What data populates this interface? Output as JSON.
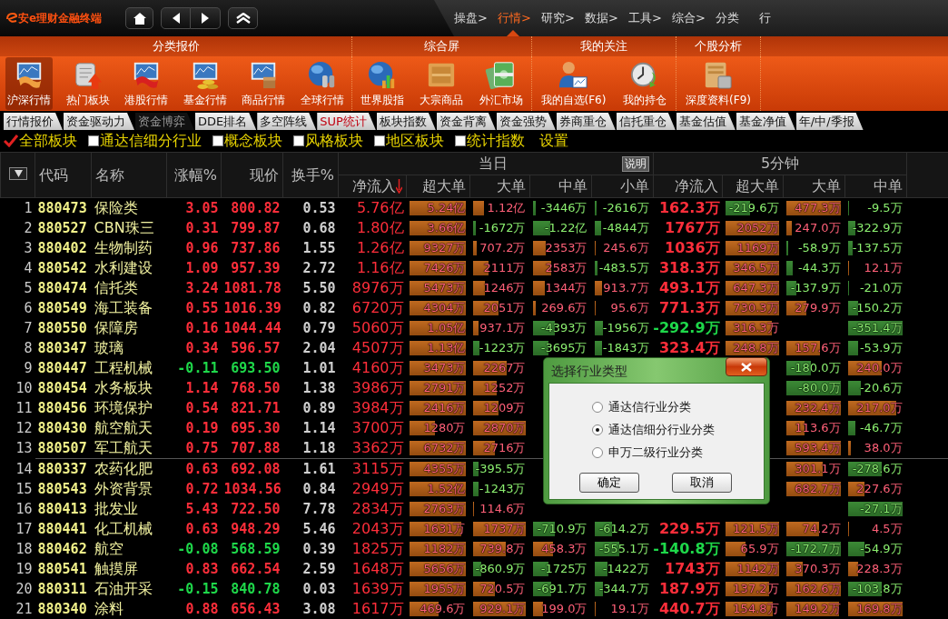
{
  "app": {
    "logo": "安e理财金融终端"
  },
  "menu": [
    {
      "label": "操盘>",
      "selected": false
    },
    {
      "label": "行情>",
      "selected": true
    },
    {
      "label": "研究>",
      "selected": false
    },
    {
      "label": "数据>",
      "selected": false
    },
    {
      "label": "工具>",
      "selected": false
    },
    {
      "label": "综合>",
      "selected": false
    },
    {
      "label": "分类",
      "selected": false
    },
    {
      "label": "行",
      "selected": false
    }
  ],
  "ribbon": {
    "groups": [
      {
        "title": "分类报价",
        "items": [
          {
            "label": "沪深行情",
            "selected": true
          },
          {
            "label": "热门板块",
            "selected": false
          },
          {
            "label": "港股行情",
            "selected": false
          },
          {
            "label": "基金行情",
            "selected": false
          },
          {
            "label": "商品行情",
            "selected": false
          },
          {
            "label": "全球行情",
            "selected": false
          }
        ]
      },
      {
        "title": "综合屏",
        "items": [
          {
            "label": "世界股指",
            "selected": false
          },
          {
            "label": "大宗商品",
            "selected": false
          },
          {
            "label": "外汇市场",
            "selected": false
          }
        ]
      },
      {
        "title": "我的关注",
        "items": [
          {
            "label": "我的自选(F6)",
            "selected": false
          },
          {
            "label": "我的持仓",
            "selected": false
          }
        ]
      },
      {
        "title": "个股分析",
        "items": [
          {
            "label": "深度资料(F9)",
            "selected": false
          }
        ]
      }
    ]
  },
  "tabs": [
    {
      "label": "行情报价",
      "selected": false,
      "highlighted": false
    },
    {
      "label": "资金驱动力",
      "selected": false,
      "highlighted": false
    },
    {
      "label": "资金博弈",
      "selected": true,
      "highlighted": false
    },
    {
      "label": "DDE排名",
      "selected": false,
      "highlighted": false
    },
    {
      "label": "多空阵线",
      "selected": false,
      "highlighted": false
    },
    {
      "label": "SUP统计",
      "selected": false,
      "highlighted": true
    },
    {
      "label": "板块指数",
      "selected": false,
      "highlighted": false
    },
    {
      "label": "资金背离",
      "selected": false,
      "highlighted": false
    },
    {
      "label": "资金强势",
      "selected": false,
      "highlighted": false
    },
    {
      "label": "券商重仓",
      "selected": false,
      "highlighted": false
    },
    {
      "label": "信托重仓",
      "selected": false,
      "highlighted": false
    },
    {
      "label": "基金估值",
      "selected": false,
      "highlighted": false
    },
    {
      "label": "基金净值",
      "selected": false,
      "highlighted": false
    },
    {
      "label": "年/中/季报",
      "selected": false,
      "highlighted": false
    }
  ],
  "filters": [
    {
      "label": "全部板块",
      "checked": true
    },
    {
      "label": "通达信细分行业",
      "checked": false
    },
    {
      "label": "概念板块",
      "checked": false
    },
    {
      "label": "风格板块",
      "checked": false
    },
    {
      "label": "地区板块",
      "checked": false
    },
    {
      "label": "统计指数",
      "checked": false
    }
  ],
  "settings_link": "设置",
  "table": {
    "columns": [
      "代码",
      "名称",
      "涨幅%",
      "现价",
      "换手%"
    ],
    "groups": [
      {
        "label": "当日",
        "note_button": "说明",
        "columns": [
          {
            "label": "净流入",
            "sorted": true
          },
          {
            "label": "超大单",
            "sorted": false
          },
          {
            "label": "大单",
            "sorted": false
          },
          {
            "label": "中单",
            "sorted": false
          },
          {
            "label": "小单",
            "sorted": false
          }
        ]
      },
      {
        "label": "5分钟",
        "columns": [
          {
            "label": "净流入",
            "sorted": false
          },
          {
            "label": "超大单",
            "sorted": false
          },
          {
            "label": "大单",
            "sorted": false
          },
          {
            "label": "中单",
            "sorted": false
          }
        ]
      }
    ],
    "rows": [
      {
        "no": "1",
        "code": "880473",
        "name": "保险类",
        "change": "3.05",
        "price": "800.82",
        "turnover": "0.53",
        "today": {
          "net": {
            "text": "5.76亿"
          },
          "super_large": {
            "text": "5.24亿",
            "level": 0.97
          },
          "large": {
            "text": "1.12亿",
            "level": 0.2
          },
          "medium": {
            "text": "-3446万",
            "level": 0.05
          },
          "small": {
            "text": "-2616万",
            "level": 0.04
          }
        },
        "five_min": {
          "net": {
            "text": "162.3万"
          },
          "super_large": {
            "text": "-219.6万",
            "level": 0.45
          },
          "large": {
            "text": "477.3万",
            "level": 0.97
          },
          "medium": {
            "text": "-9.5万",
            "level": 0.03
          }
        }
      },
      {
        "no": "2",
        "code": "880527",
        "name": "CBN珠三",
        "change": "0.31",
        "price": "799.87",
        "turnover": "0.68",
        "today": {
          "net": {
            "text": "1.80亿"
          },
          "super_large": {
            "text": "3.66亿",
            "level": 0.97
          },
          "large": {
            "text": "-1672万",
            "level": 0.05
          },
          "medium": {
            "text": "-1.22亿",
            "level": 0.32
          },
          "small": {
            "text": "-4844万",
            "level": 0.12
          }
        },
        "five_min": {
          "net": {
            "text": "1767万"
          },
          "super_large": {
            "text": "2052万",
            "level": 0.97
          },
          "large": {
            "text": "247.0万",
            "level": 0.1
          },
          "medium": {
            "text": "-322.9万",
            "level": 0.14
          }
        }
      },
      {
        "no": "3",
        "code": "880402",
        "name": "生物制药",
        "change": "0.96",
        "price": "737.86",
        "turnover": "1.55",
        "today": {
          "net": {
            "text": "1.26亿"
          },
          "super_large": {
            "text": "9327万",
            "level": 0.97
          },
          "large": {
            "text": "707.2万",
            "level": 0.08
          },
          "medium": {
            "text": "2353万",
            "level": 0.24
          },
          "small": {
            "text": "245.6万",
            "level": 0.03
          }
        },
        "five_min": {
          "net": {
            "text": "1036万"
          },
          "super_large": {
            "text": "1169万",
            "level": 0.97
          },
          "large": {
            "text": "-58.9万",
            "level": 0.04
          },
          "medium": {
            "text": "-137.5万",
            "level": 0.09
          }
        }
      },
      {
        "no": "4",
        "code": "880542",
        "name": "水利建设",
        "change": "1.09",
        "price": "957.39",
        "turnover": "2.72",
        "today": {
          "net": {
            "text": "1.16亿"
          },
          "super_large": {
            "text": "7426万",
            "level": 0.97
          },
          "large": {
            "text": "2111万",
            "level": 0.29
          },
          "medium": {
            "text": "2583万",
            "level": 0.33
          },
          "small": {
            "text": "-483.5万",
            "level": 0.05
          }
        },
        "five_min": {
          "net": {
            "text": "318.3万"
          },
          "super_large": {
            "text": "346.5万",
            "level": 0.97
          },
          "large": {
            "text": "-44.3万",
            "level": 0.12
          },
          "medium": {
            "text": "12.1万",
            "level": 0.02
          }
        }
      },
      {
        "no": "5",
        "code": "880474",
        "name": "信托类",
        "change": "3.24",
        "price": "1081.78",
        "turnover": "5.50",
        "today": {
          "net": {
            "text": "8976万"
          },
          "super_large": {
            "text": "5473万",
            "level": 0.97
          },
          "large": {
            "text": "1246万",
            "level": 0.23
          },
          "medium": {
            "text": "1344万",
            "level": 0.22
          },
          "small": {
            "text": "913.7万",
            "level": 0.14
          }
        },
        "five_min": {
          "net": {
            "text": "493.1万"
          },
          "super_large": {
            "text": "647.3万",
            "level": 0.97
          },
          "large": {
            "text": "-137.9万",
            "level": 0.19
          },
          "medium": {
            "text": "-21.0万",
            "level": 0.02
          }
        }
      },
      {
        "no": "6",
        "code": "880549",
        "name": "海工装备",
        "change": "0.55",
        "price": "1016.39",
        "turnover": "0.82",
        "today": {
          "net": {
            "text": "6720万"
          },
          "super_large": {
            "text": "4304万",
            "level": 0.97
          },
          "large": {
            "text": "2051万",
            "level": 0.47
          },
          "medium": {
            "text": "269.6万",
            "level": 0.05
          },
          "small": {
            "text": "95.6万",
            "level": 0.02
          }
        },
        "five_min": {
          "net": {
            "text": "771.3万"
          },
          "super_large": {
            "text": "730.3万",
            "level": 0.97
          },
          "large": {
            "text": "279.9万",
            "level": 0.36
          },
          "medium": {
            "text": "-150.2万",
            "level": 0.19
          }
        }
      },
      {
        "no": "7",
        "code": "880550",
        "name": "保障房",
        "change": "0.16",
        "price": "1044.44",
        "turnover": "0.79",
        "today": {
          "net": {
            "text": "5060万"
          },
          "super_large": {
            "text": "1.05亿",
            "level": 0.97
          },
          "large": {
            "text": "937.1万",
            "level": 0.1
          },
          "medium": {
            "text": "-4393万",
            "level": 0.39
          },
          "small": {
            "text": "-1956万",
            "level": 0.15
          }
        },
        "five_min": {
          "net": {
            "text": "-292.9万"
          },
          "super_large": {
            "text": "316.3万",
            "level": 0.85
          },
          "medium": {
            "text": "-351.4万",
            "level": 0.97
          }
        }
      },
      {
        "no": "8",
        "code": "880347",
        "name": "玻璃",
        "change": "0.34",
        "price": "596.57",
        "turnover": "2.04",
        "today": {
          "net": {
            "text": "4507万"
          },
          "super_large": {
            "text": "1.13亿",
            "level": 0.97
          },
          "large": {
            "text": "-1223万",
            "level": 0.12
          },
          "medium": {
            "text": "-3695万",
            "level": 0.29
          },
          "small": {
            "text": "-1843万",
            "level": 0.14
          }
        },
        "five_min": {
          "net": {
            "text": "323.4万"
          },
          "super_large": {
            "text": "248.8万",
            "level": 0.97
          },
          "large": {
            "text": "157.6万",
            "level": 0.6
          },
          "medium": {
            "text": "-53.9万",
            "level": 0.19
          }
        }
      },
      {
        "no": "9",
        "code": "880447",
        "name": "工程机械",
        "change": "-0.11",
        "price": "693.50",
        "turnover": "1.01",
        "today": {
          "net": {
            "text": "4160万"
          },
          "super_large": {
            "text": "3473万",
            "level": 0.97
          },
          "large": {
            "text": "2267万",
            "level": 0.62
          }
        },
        "five_min": {
          "large": {
            "text": "-180.0万",
            "level": 0.45
          },
          "medium": {
            "text": "240.0万",
            "level": 0.6
          }
        }
      },
      {
        "no": "10",
        "code": "880454",
        "name": "水务板块",
        "change": "1.14",
        "price": "768.50",
        "turnover": "1.38",
        "today": {
          "net": {
            "text": "3986万"
          },
          "super_large": {
            "text": "2791万",
            "level": 0.97
          },
          "large": {
            "text": "1252万",
            "level": 0.44
          }
        },
        "five_min": {
          "large": {
            "text": "-80.0万",
            "level": 0.97
          },
          "medium": {
            "text": "-20.6万",
            "level": 0.23
          }
        }
      },
      {
        "no": "11",
        "code": "880456",
        "name": "环境保护",
        "change": "0.54",
        "price": "821.71",
        "turnover": "0.89",
        "today": {
          "net": {
            "text": "3984万"
          },
          "super_large": {
            "text": "2416万",
            "level": 0.97
          },
          "large": {
            "text": "1209万",
            "level": 0.48
          }
        },
        "five_min": {
          "large": {
            "text": "232.4万",
            "level": 0.97
          },
          "medium": {
            "text": "217.0万",
            "level": 0.86
          }
        }
      },
      {
        "no": "12",
        "code": "880430",
        "name": "航空航天",
        "change": "0.19",
        "price": "695.30",
        "turnover": "1.14",
        "today": {
          "net": {
            "text": "3700万"
          },
          "super_large": {
            "text": "1280万",
            "level": 0.44
          },
          "large": {
            "text": "2870万",
            "level": 0.97
          }
        },
        "five_min": {
          "large": {
            "text": "113.6万",
            "level": 0.33
          },
          "medium": {
            "text": "-46.7万",
            "level": 0.13
          }
        }
      },
      {
        "no": "13",
        "code": "880507",
        "name": "军工航天",
        "change": "0.75",
        "price": "707.88",
        "turnover": "1.18",
        "today": {
          "net": {
            "text": "3362万"
          },
          "super_large": {
            "text": "6732万",
            "level": 0.97
          },
          "large": {
            "text": "2716万",
            "level": 0.41
          }
        },
        "five_min": {
          "large": {
            "text": "593.4万",
            "level": 0.97
          },
          "medium": {
            "text": "38.0万",
            "level": 0.05
          }
        }
      },
      {
        "no": "14",
        "code": "880337",
        "name": "农药化肥",
        "change": "0.63",
        "price": "692.08",
        "turnover": "1.61",
        "today": {
          "net": {
            "text": "3115万"
          },
          "super_large": {
            "text": "4355万",
            "level": 0.97
          },
          "large": {
            "text": "-395.5万",
            "level": 0.1
          }
        },
        "five_min": {
          "large": {
            "text": "301.1万",
            "level": 0.66
          },
          "medium": {
            "text": "-278.6万",
            "level": 0.6
          }
        }
      },
      {
        "no": "15",
        "code": "880543",
        "name": "外资背景",
        "change": "0.72",
        "price": "1034.56",
        "turnover": "0.84",
        "today": {
          "net": {
            "text": "2949万"
          },
          "super_large": {
            "text": "1.52亿",
            "level": 0.97
          },
          "large": {
            "text": "-1243万",
            "level": 0.1
          }
        },
        "five_min": {
          "large": {
            "text": "682.7万",
            "level": 0.97
          },
          "medium": {
            "text": "227.6万",
            "level": 0.3
          }
        }
      },
      {
        "no": "16",
        "code": "880413",
        "name": "批发业",
        "change": "5.43",
        "price": "722.50",
        "turnover": "7.78",
        "today": {
          "net": {
            "text": "2834万"
          },
          "super_large": {
            "text": "2763万",
            "level": 0.97
          },
          "large": {
            "text": "114.6万",
            "level": 0.02
          }
        },
        "five_min": {
          "medium": {
            "text": "-27.1万",
            "level": 0.97
          }
        }
      },
      {
        "no": "17",
        "code": "880441",
        "name": "化工机械",
        "change": "0.63",
        "price": "948.29",
        "turnover": "5.46",
        "today": {
          "net": {
            "text": "2043万"
          },
          "super_large": {
            "text": "1631万",
            "level": 0.9
          },
          "large": {
            "text": "1737万",
            "level": 0.97
          },
          "medium": {
            "text": "-710.9万",
            "level": 0.39
          },
          "small": {
            "text": "-614.2万",
            "level": 0.32
          }
        },
        "five_min": {
          "net": {
            "text": "229.5万"
          },
          "super_large": {
            "text": "121.5万",
            "level": 0.97
          },
          "large": {
            "text": "74.2万",
            "level": 0.58
          },
          "medium": {
            "text": "4.5万",
            "level": 0.02
          }
        }
      },
      {
        "no": "18",
        "code": "880462",
        "name": "航空",
        "change": "-0.08",
        "price": "568.59",
        "turnover": "0.39",
        "today": {
          "net": {
            "text": "1825万"
          },
          "super_large": {
            "text": "1182万",
            "level": 0.97
          },
          "large": {
            "text": "739.8万",
            "level": 0.6
          },
          "medium": {
            "text": "458.3万",
            "level": 0.36
          },
          "small": {
            "text": "-555.1万",
            "level": 0.45
          }
        },
        "five_min": {
          "net": {
            "text": "-140.8万"
          },
          "super_large": {
            "text": "65.9万",
            "level": 0.36
          },
          "large": {
            "text": "-172.7万",
            "level": 0.97
          },
          "medium": {
            "text": "-54.9万",
            "level": 0.29
          }
        }
      },
      {
        "no": "19",
        "code": "880541",
        "name": "触摸屏",
        "change": "0.83",
        "price": "662.54",
        "turnover": "2.59",
        "today": {
          "net": {
            "text": "1648万"
          },
          "super_large": {
            "text": "5656万",
            "level": 0.97
          },
          "large": {
            "text": "-860.9万",
            "level": 0.15
          },
          "medium": {
            "text": "-1725万",
            "level": 0.28
          },
          "small": {
            "text": "-1422万",
            "level": 0.23
          }
        },
        "five_min": {
          "net": {
            "text": "1743万"
          },
          "super_large": {
            "text": "1142万",
            "level": 0.97
          },
          "large": {
            "text": "370.3万",
            "level": 0.3
          },
          "medium": {
            "text": "228.3万",
            "level": 0.18
          }
        }
      },
      {
        "no": "20",
        "code": "880311",
        "name": "石油开采",
        "change": "-0.15",
        "price": "840.78",
        "turnover": "0.03",
        "today": {
          "net": {
            "text": "1639万"
          },
          "super_large": {
            "text": "1955万",
            "level": 0.97
          },
          "large": {
            "text": "720.5万",
            "level": 0.4
          },
          "medium": {
            "text": "-691.7万",
            "level": 0.33
          },
          "small": {
            "text": "-344.7万",
            "level": 0.16
          }
        },
        "five_min": {
          "net": {
            "text": "187.9万"
          },
          "super_large": {
            "text": "137.2万",
            "level": 0.8
          },
          "large": {
            "text": "162.6万",
            "level": 0.97
          },
          "medium": {
            "text": "-103.8万",
            "level": 0.6
          }
        }
      },
      {
        "no": "21",
        "code": "880340",
        "name": "涂料",
        "change": "0.88",
        "price": "656.43",
        "turnover": "3.08",
        "today": {
          "net": {
            "text": "1617万"
          },
          "super_large": {
            "text": "469.6万",
            "level": 0.5
          },
          "large": {
            "text": "929.1万",
            "level": 0.97
          },
          "medium": {
            "text": "199.0万",
            "level": 0.19
          },
          "small": {
            "text": "19.1万",
            "level": 0.02
          }
        },
        "five_min": {
          "net": {
            "text": "440.7万"
          },
          "super_large": {
            "text": "154.8万",
            "level": 0.86
          },
          "large": {
            "text": "149.2万",
            "level": 0.95
          },
          "medium": {
            "text": "169.8万",
            "level": 0.97
          }
        }
      }
    ]
  },
  "dialog": {
    "title": "选择行业类型",
    "options": [
      {
        "label": "通达信行业分类",
        "selected": false
      },
      {
        "label": "通达信细分行业分类",
        "selected": true
      },
      {
        "label": "申万二级行业分类",
        "selected": false
      }
    ],
    "buttons": [
      "确定",
      "取消"
    ]
  }
}
